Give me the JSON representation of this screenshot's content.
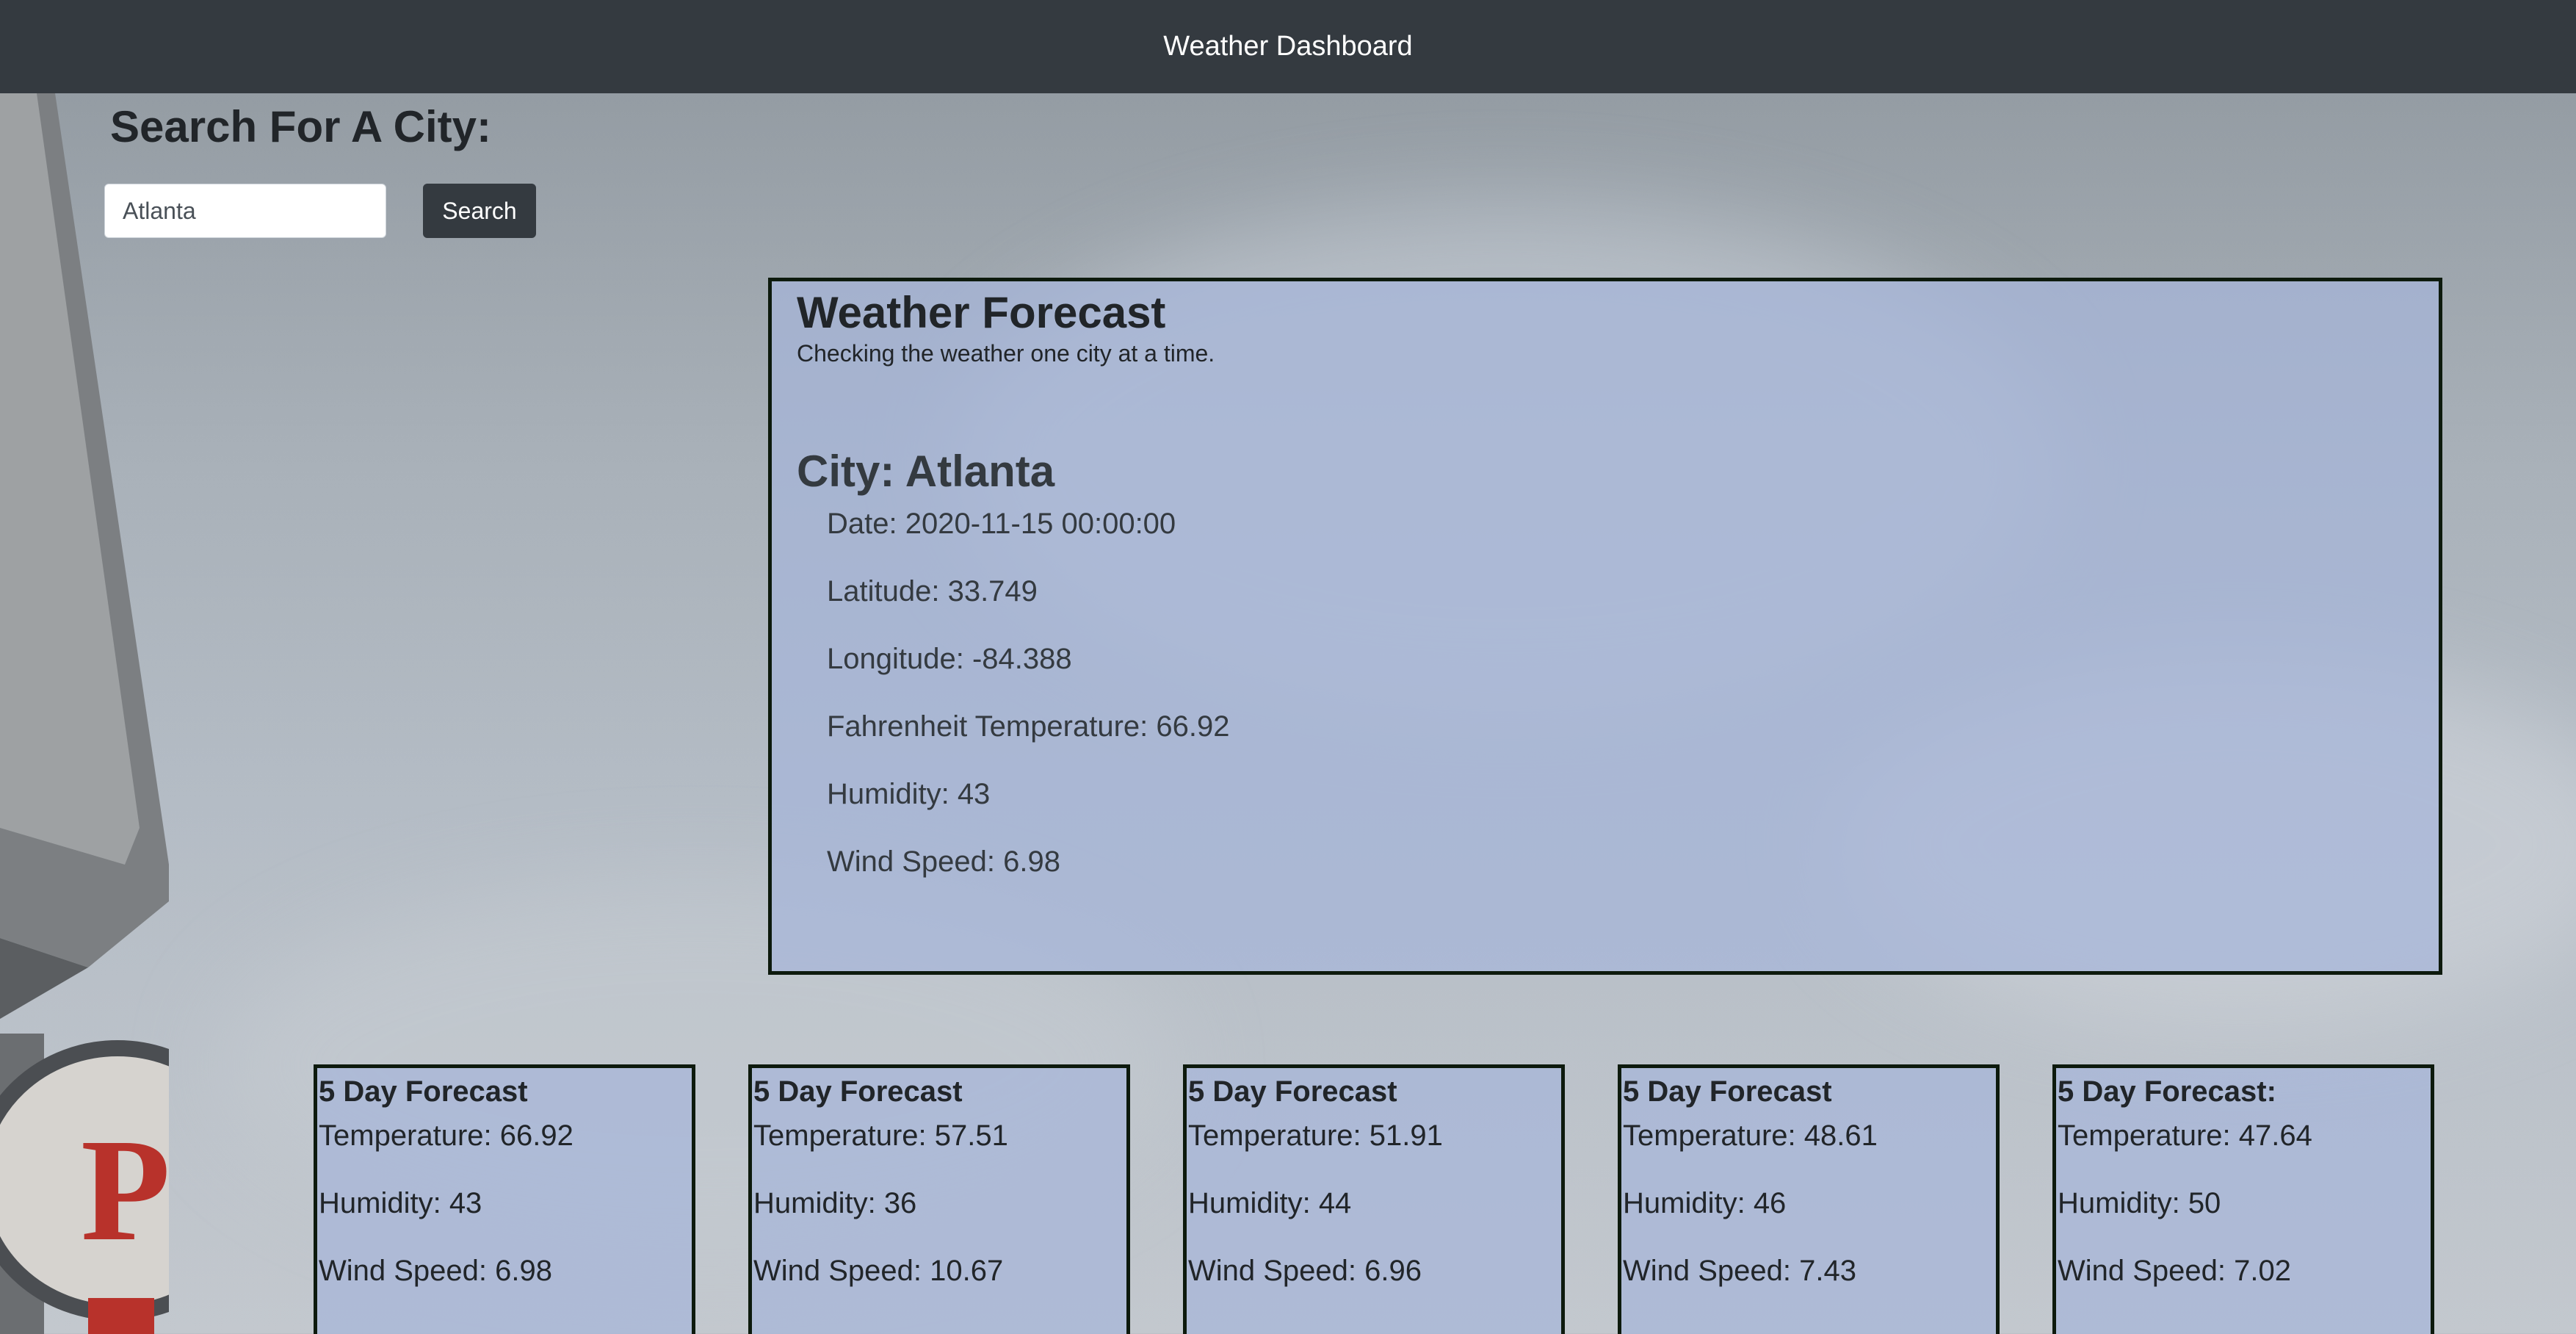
{
  "navbar": {
    "title": "Weather Dashboard"
  },
  "search": {
    "heading": "Search For A City:",
    "input_value": "Atlanta",
    "button_label": "Search"
  },
  "current": {
    "title": "Weather Forecast",
    "subtitle": "Checking the weather one city at a time.",
    "city": "City: Atlanta",
    "details": [
      "Date: 2020-11-15 00:00:00",
      "Latitude: 33.749",
      "Longitude: -84.388",
      "Fahrenheit Temperature: 66.92",
      "Humidity: 43",
      "Wind Speed: 6.98"
    ]
  },
  "forecast": [
    {
      "title": "5 Day Forecast",
      "temperature": "Temperature: 66.92",
      "humidity": "Humidity: 43",
      "wind": "Wind Speed: 6.98"
    },
    {
      "title": "5 Day Forecast",
      "temperature": "Temperature: 57.51",
      "humidity": "Humidity: 36",
      "wind": "Wind Speed: 10.67"
    },
    {
      "title": "5 Day Forecast",
      "temperature": "Temperature: 51.91",
      "humidity": "Humidity: 44",
      "wind": "Wind Speed: 6.96"
    },
    {
      "title": "5 Day Forecast",
      "temperature": "Temperature: 48.61",
      "humidity": "Humidity: 46",
      "wind": "Wind Speed: 7.43"
    },
    {
      "title": "5 Day Forecast:",
      "temperature": "Temperature: 47.64",
      "humidity": "Humidity: 50",
      "wind": "Wind Speed: 7.02"
    }
  ],
  "colors": {
    "navbar": "#343a40",
    "card_background": "#a6b6da",
    "card_border": "#0d1a0d",
    "sign_red": "#b8322b"
  }
}
